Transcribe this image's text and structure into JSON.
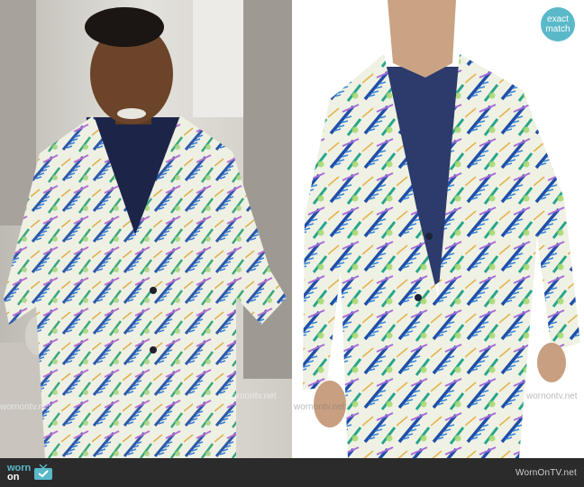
{
  "images": {
    "left_alt": "Man wearing tropical leaf print blazer over navy shirt",
    "right_alt": "Model wearing matching tropical leaf print suit blazer over navy tee"
  },
  "watermarks": {
    "left_lines": [
      "wornontv.net",
      "wornontv.net"
    ],
    "right_lines": [
      "wornontv.net",
      "wornontv.net"
    ]
  },
  "badge": {
    "line1": "exact",
    "line2": "match",
    "color": "#5ab9c9"
  },
  "footer": {
    "logo_top": "worn",
    "logo_bottom": "on",
    "logo_icon": "tv-icon",
    "site": "WornOnTV.net",
    "background": "#2b2b2b",
    "accent": "#5ab9c9"
  }
}
